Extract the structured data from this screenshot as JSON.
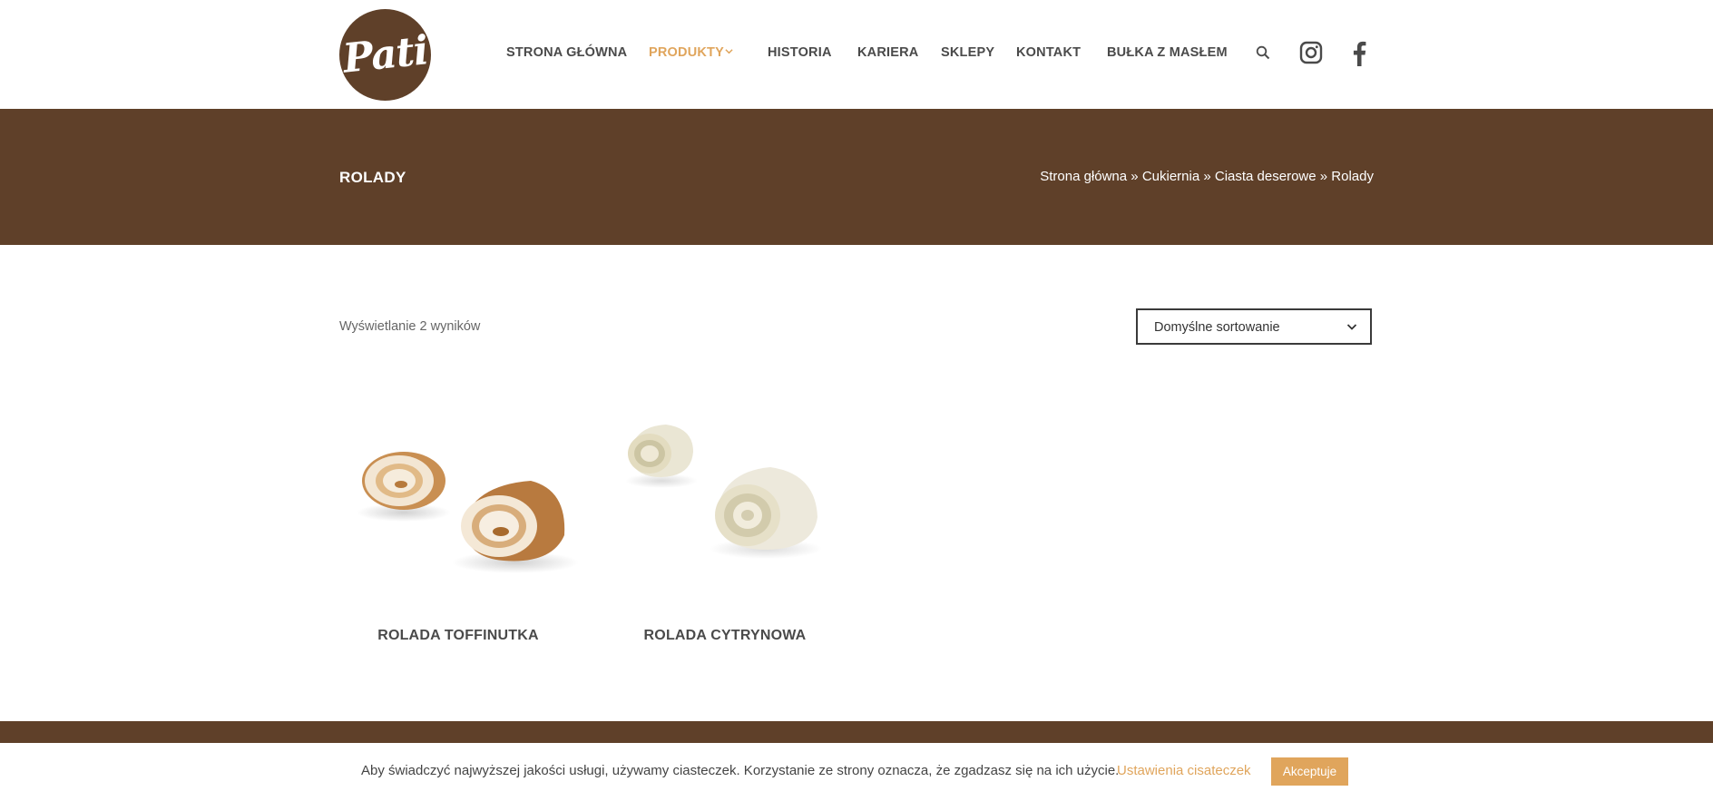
{
  "brand": {
    "logo_text": "Pati",
    "primary_color": "#5f4029",
    "accent_color": "#e0a55c"
  },
  "nav": {
    "items": [
      {
        "label": "STRONA GŁÓWNA"
      },
      {
        "label": "PRODUKTY"
      },
      {
        "label": "HISTORIA"
      },
      {
        "label": "KARIERA"
      },
      {
        "label": "SKLEPY"
      },
      {
        "label": "KONTAKT"
      },
      {
        "label": "BUŁKA Z MASŁEM"
      }
    ],
    "active": "PRODUKTY",
    "icons": [
      "search-icon",
      "instagram-icon",
      "facebook-icon"
    ]
  },
  "banner": {
    "title": "ROLADY",
    "breadcrumb": {
      "home": "Strona główna",
      "c1": "Cukiernia",
      "c2": "Ciasta deserowe",
      "current": "Rolady",
      "sep": "»"
    }
  },
  "toolbar": {
    "result_count": "Wyświetlanie 2 wyników",
    "sort_selected": "Domyślne sortowanie"
  },
  "products": [
    {
      "name": "ROLADA TOFFINUTKA"
    },
    {
      "name": "ROLADA CYTRYNOWA"
    }
  ],
  "cookie": {
    "text": "Aby świadczyć najwyższej jakości usługi, używamy ciasteczek. Korzystanie ze strony oznacza, że zgadzasz się na ich użycie.",
    "settings_link": "Ustawienia cisateczek",
    "accept_button": "Akceptuje"
  }
}
